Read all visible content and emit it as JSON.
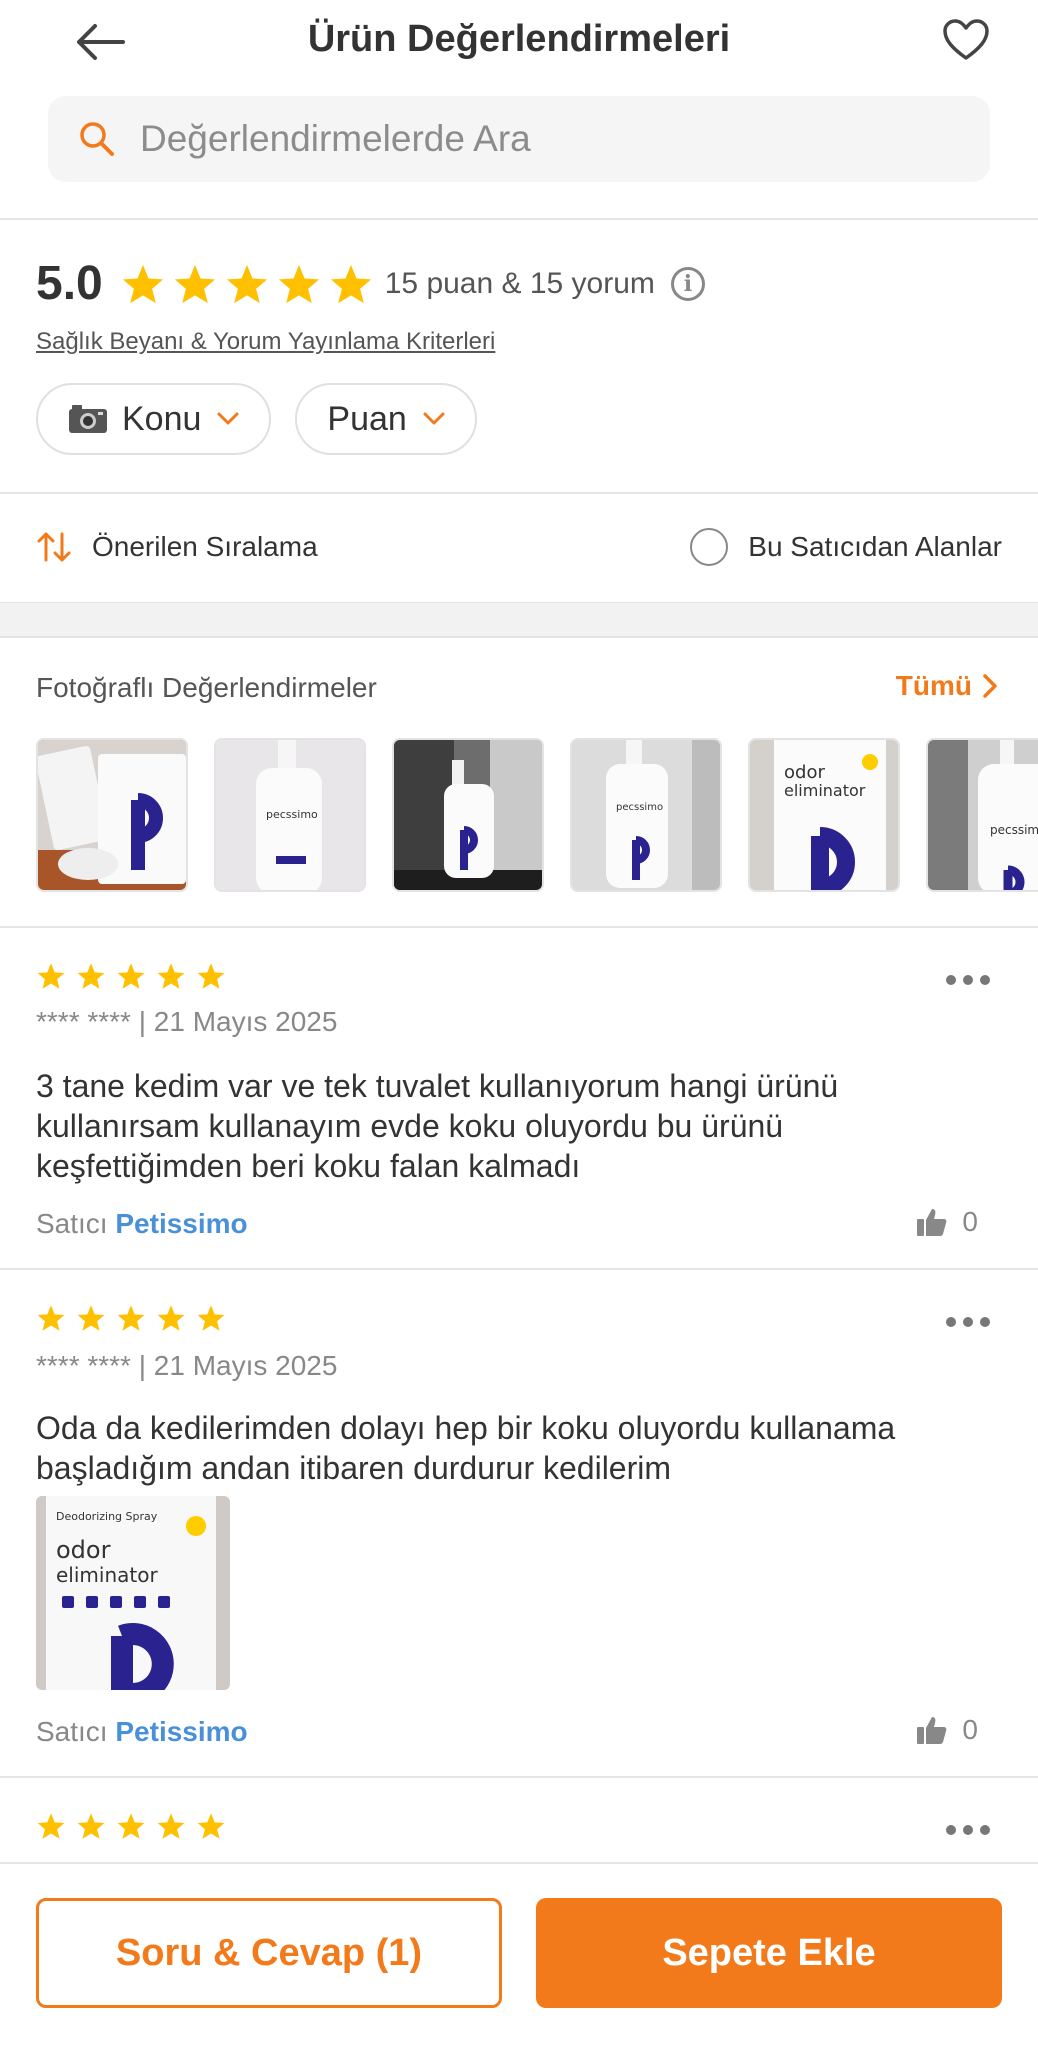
{
  "header": {
    "title": "Ürün Değerlendirmeleri",
    "back_icon": "arrow-left-icon",
    "favorite_icon": "heart-outline-icon"
  },
  "search": {
    "placeholder": "Değerlendirmelerde Ara",
    "icon": "search-icon",
    "icon_color": "#f27a1a"
  },
  "summary": {
    "score": "5.0",
    "stars": 5,
    "count_text": "15 puan & 15 yorum",
    "criteria_link": "Sağlık Beyanı & Yorum Yayınlama Kriterleri"
  },
  "filters": [
    {
      "label": "Konu",
      "icon": "camera-icon"
    },
    {
      "label": "Puan"
    }
  ],
  "sorting": {
    "label": "Önerilen Sıralama",
    "seller_filter_label": "Bu Satıcıdan Alanlar",
    "seller_filter_checked": false
  },
  "photo_reviews": {
    "title": "Fotoğraflı Değerlendirmeler",
    "all_label": "Tümü",
    "thumbnail_count": 6
  },
  "reviews": [
    {
      "rating": 5,
      "author": "**** ****",
      "date": "| 21 Mayıs 2025",
      "text": "3 tane kedim  var ve tek tuvalet kullanıyorum hangi ürünü kullanırsam kullanayım evde koku oluyordu bu ürünü keşfettiğimden beri koku falan kalmadı",
      "seller_prefix": "Satıcı",
      "seller": "Petissimo",
      "likes": "0"
    },
    {
      "rating": 5,
      "author": "**** ****",
      "date": "| 21 Mayıs 2025",
      "text": "Oda da kedilerimden dolayı hep bir koku oluyordu kullanama başladığım andan itibaren durdurur kedilerim",
      "has_image": true,
      "seller_prefix": "Satıcı",
      "seller": "Petissimo",
      "likes": "0"
    },
    {
      "rating": 5
    }
  ],
  "bottom_bar": {
    "qa_label": "Soru & Cevap (1)",
    "cart_label": "Sepete Ekle"
  },
  "colors": {
    "accent": "#f27a1a",
    "star": "#ffc000",
    "seller_link": "#4a90d9"
  }
}
